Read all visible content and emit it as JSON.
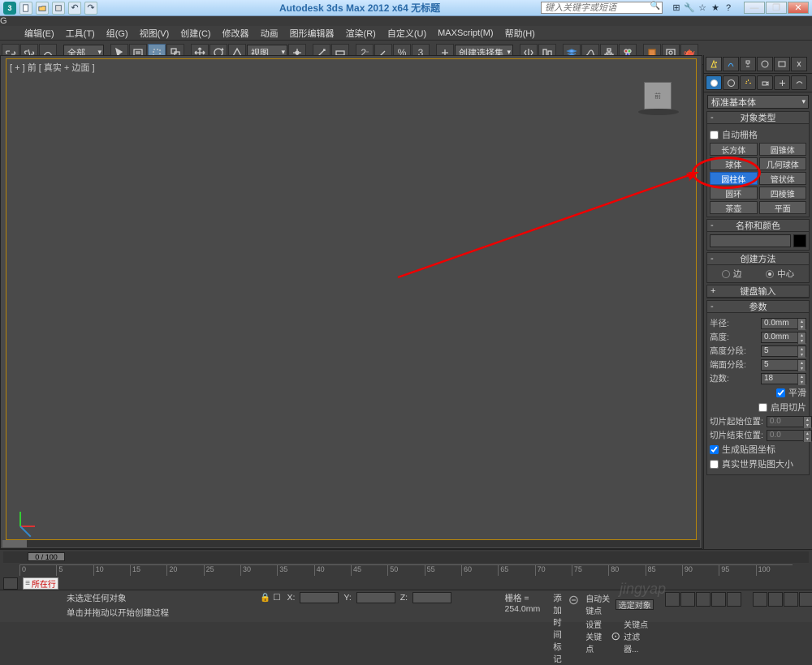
{
  "title": "Autodesk 3ds Max 2012 x64   无标题",
  "search_placeholder": "键入关键字或短语",
  "menu": [
    "编辑(E)",
    "工具(T)",
    "组(G)",
    "视图(V)",
    "创建(C)",
    "修改器",
    "动画",
    "图形编辑器",
    "渲染(R)",
    "自定义(U)",
    "MAXScript(M)",
    "帮助(H)"
  ],
  "toolbar": {
    "sel_filter": "全部",
    "ref_mode": "视图",
    "named_sel": "创建选择集"
  },
  "viewport_label": "[ + ] 前 [ 真实 + 边面 ]",
  "cmd": {
    "category": "标准基本体",
    "roll_obj_type": "对象类型",
    "auto_grid": "自动栅格",
    "objs": [
      [
        "长方体",
        "圆锥体"
      ],
      [
        "球体",
        "几何球体"
      ],
      [
        "圆柱体",
        "管状体"
      ],
      [
        "圆环",
        "四棱锥"
      ],
      [
        "茶壶",
        "平面"
      ]
    ],
    "selected_obj": "圆柱体",
    "roll_name": "名称和颜色",
    "roll_method": "创建方法",
    "method_edge": "边",
    "method_center": "中心",
    "roll_kb": "键盘输入",
    "roll_params": "参数",
    "p_radius": "半径:",
    "p_height": "高度:",
    "p_hseg": "高度分段:",
    "p_cseg": "端面分段:",
    "p_sides": "边数:",
    "v_radius": "0.0mm",
    "v_height": "0.0mm",
    "v_hseg": "5",
    "v_cseg": "5",
    "v_sides": "18",
    "chk_smooth": "平滑",
    "chk_slice": "启用切片",
    "slice_from": "切片起始位置:",
    "slice_to": "切片结束位置:",
    "v_slice": "0.0",
    "chk_mapcoord": "生成贴图坐标",
    "chk_realworld": "真实世界贴图大小"
  },
  "time": {
    "slider": "0 / 100",
    "ticks": [
      "0",
      "5",
      "10",
      "15",
      "20",
      "25",
      "30",
      "35",
      "40",
      "45",
      "50",
      "55",
      "60",
      "65",
      "70",
      "75",
      "80",
      "85",
      "90",
      "95",
      "100"
    ]
  },
  "status": {
    "mode": "所在行",
    "msg1": "未选定任何对象",
    "msg2": "单击并拖动以开始创建过程",
    "addtag": "添加时间标记",
    "grid": "栅格 = 254.0mm",
    "autokey": "自动关键点",
    "setkey": "设置关键点",
    "sel": "选定对象",
    "filter": "关键点过滤器..."
  },
  "watermark": "jingyap"
}
